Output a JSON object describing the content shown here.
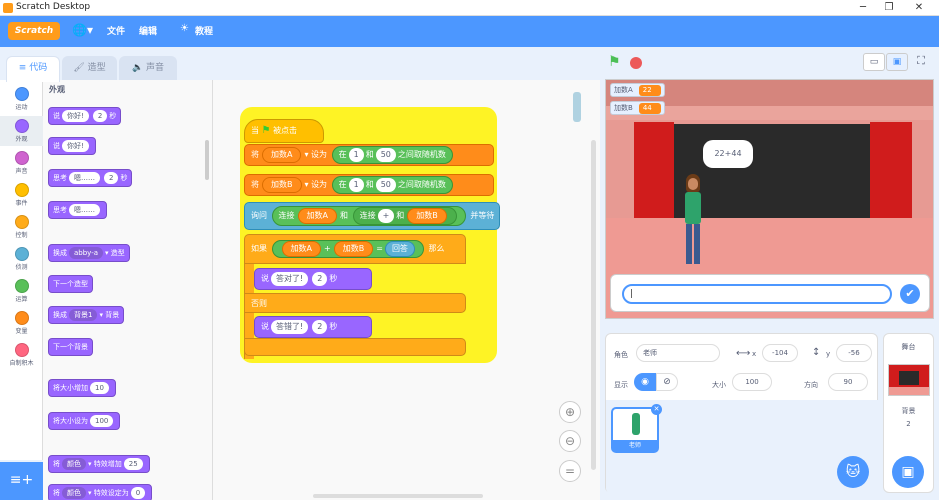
{
  "window": {
    "title": "Scratch Desktop"
  },
  "menu": {
    "logo": "Scratch",
    "file": "文件",
    "edit": "编辑",
    "tutorials": "教程"
  },
  "tabs": {
    "code": "代码",
    "costumes": "造型",
    "sounds": "声音"
  },
  "categories": [
    {
      "label": "运动",
      "color": "#4c97ff"
    },
    {
      "label": "外观",
      "color": "#9966ff"
    },
    {
      "label": "声音",
      "color": "#cf63cf"
    },
    {
      "label": "事件",
      "color": "#ffbf00"
    },
    {
      "label": "控制",
      "color": "#ffab19"
    },
    {
      "label": "侦测",
      "color": "#5cb1d6"
    },
    {
      "label": "运算",
      "color": "#59c059"
    },
    {
      "label": "变量",
      "color": "#ff8c1a"
    },
    {
      "label": "自制积木",
      "color": "#ff6680"
    }
  ],
  "palette": {
    "section": "外观",
    "say_for": {
      "label": "说",
      "text": "你好!",
      "secs": "2",
      "unit": "秒"
    },
    "say": {
      "label": "说",
      "text": "你好!"
    },
    "think_for": {
      "label": "思考",
      "text": "嗯……",
      "secs": "2",
      "unit": "秒"
    },
    "think": {
      "label": "思考",
      "text": "嗯……"
    },
    "switch_costume": {
      "label": "换成",
      "value": "abby-a",
      "suffix": "造型"
    },
    "next_costume": "下一个造型",
    "switch_backdrop": {
      "label": "换成",
      "value": "背景1",
      "suffix": "背景"
    },
    "next_backdrop": "下一个背景",
    "change_size": {
      "label": "将大小增加",
      "value": "10"
    },
    "set_size": {
      "label": "将大小设为",
      "value": "100"
    },
    "change_effect": {
      "label": "将",
      "value": "颜色",
      "mid": "特效增加",
      "num": "25"
    },
    "set_effect": {
      "label": "将",
      "value": "颜色",
      "mid": "特效设定为",
      "num": "0"
    }
  },
  "script": {
    "hat": {
      "when": "当",
      "clicked": "被点击"
    },
    "set_a": {
      "set": "将",
      "var": "加数A",
      "to": "设为",
      "in": "在",
      "from": "1",
      "and": "和",
      "upto": "50",
      "random": "之间取随机数"
    },
    "set_b": {
      "set": "将",
      "var": "加数B",
      "to": "设为",
      "in": "在",
      "from": "1",
      "and": "和",
      "upto": "50",
      "random": "之间取随机数"
    },
    "ask": {
      "ask": "询问",
      "join": "连接",
      "var_a": "加数A",
      "and": "和",
      "join2": "连接",
      "plus": "+",
      "and2": "和",
      "var_b": "加数B",
      "wait": "并等待"
    },
    "if": {
      "if": "如果",
      "var_a": "加数A",
      "plus": "+",
      "var_b": "加数B",
      "eq": "=",
      "answer": "回答",
      "then": "那么"
    },
    "say_right": {
      "say": "说",
      "text": "答对了!",
      "secs": "2",
      "unit": "秒"
    },
    "else": "否则",
    "say_wrong": {
      "say": "说",
      "text": "答错了!",
      "secs": "2",
      "unit": "秒"
    }
  },
  "stage": {
    "monitors": [
      {
        "name": "加数A",
        "value": "22"
      },
      {
        "name": "加数B",
        "value": "44"
      }
    ],
    "speech": "22+44",
    "answer_value": "|"
  },
  "sprite_info": {
    "sprite_label": "角色",
    "sprite_name": "老师",
    "x_label": "x",
    "x_value": "-104",
    "y_label": "y",
    "y_value": "-56",
    "show_label": "显示",
    "size_label": "大小",
    "size_value": "100",
    "dir_label": "方向",
    "dir_value": "90",
    "thumb_label": "老师"
  },
  "stage_pane": {
    "title": "舞台",
    "backdrops_label": "背景",
    "backdrops_count": "2"
  },
  "colors": {
    "motion": "#4c97ff",
    "looks": "#9966ff",
    "control": "#ffab19",
    "sensing": "#5cb1d6",
    "operators": "#59c059",
    "variables": "#ff8c1a"
  }
}
